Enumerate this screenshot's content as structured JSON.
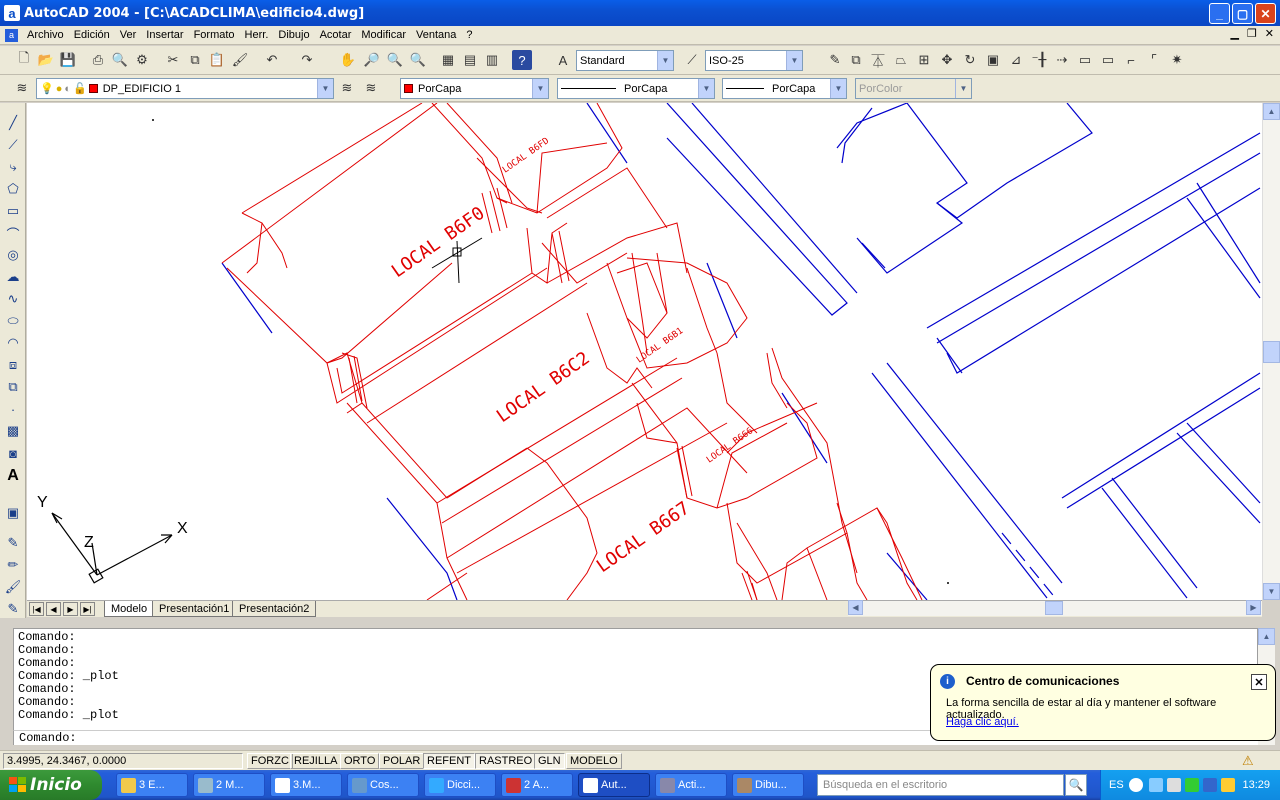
{
  "window": {
    "title": "AutoCAD 2004 - [C:\\ACADCLIMA\\edificio4.dwg]",
    "min_glyph": "_",
    "max_glyph": "▢",
    "close_glyph": "✕"
  },
  "menu": {
    "items": [
      "Archivo",
      "Edición",
      "Ver",
      "Insertar",
      "Formato",
      "Herr.",
      "Dibujo",
      "Acotar",
      "Modificar",
      "Ventana",
      "?"
    ]
  },
  "toolbar": {
    "text_style": "Standard",
    "dim_style": "ISO-25",
    "layer": "DP_EDIFICIO 1",
    "color": "PorCapa",
    "linetype": "PorCapa",
    "lineweight": "PorCapa",
    "plotstyle": "PorColor"
  },
  "drawing": {
    "labels": [
      "LOCAL B6F0",
      "LOCAL B6C2",
      "LOCAL B667",
      "LOCAL B6FD",
      "LOCAL B6B1",
      "LOCAL B666"
    ],
    "ucs": {
      "x": "X",
      "y": "Y",
      "z": "Z"
    },
    "colors": {
      "red": "#e00000",
      "blue": "#0000cc"
    }
  },
  "tabs": [
    "Modelo",
    "Presentación1",
    "Presentación2"
  ],
  "command": {
    "history": [
      "Comando:",
      "Comando:",
      "Comando:",
      "Comando: _plot",
      "Comando:",
      "Comando:",
      "Comando: _plot"
    ],
    "prompt": "Comando:"
  },
  "status": {
    "coords": "3.4995, 24.3467, 0.0000",
    "buttons": [
      "FORZC",
      "REJILLA",
      "ORTO",
      "POLAR",
      "REFENT",
      "RASTREO",
      "GLN",
      "MODELO"
    ]
  },
  "balloon": {
    "title": "Centro de comunicaciones",
    "body": "La forma sencilla de estar al día y mantener el software actualizado.",
    "link": "Haga clic aquí."
  },
  "taskbar": {
    "start": "Inicio",
    "tasks": [
      "3 E...",
      "2 M...",
      "3.M...",
      "Cos...",
      "Dicci...",
      "2 A...",
      "Aut...",
      "Acti...",
      "Dibu..."
    ],
    "search_placeholder": "Búsqueda en el escritorio",
    "lang": "ES",
    "clock": "13:29"
  }
}
